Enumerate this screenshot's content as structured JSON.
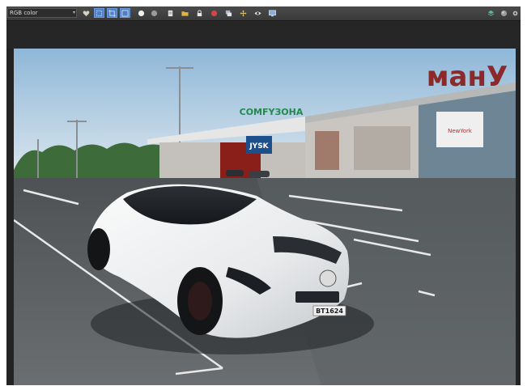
{
  "toolbar": {
    "channel_select_value": "RGB color",
    "tools": [
      {
        "name": "heart-icon",
        "active": false
      },
      {
        "name": "region-select-icon",
        "active": true
      },
      {
        "name": "crop-icon",
        "active": true
      },
      {
        "name": "frame-icon",
        "active": true
      },
      {
        "name": "white-circle-icon",
        "active": false
      },
      {
        "name": "gray-circle-icon",
        "active": false
      },
      {
        "name": "document-icon",
        "active": false
      },
      {
        "name": "folder-icon",
        "active": false
      },
      {
        "name": "lock-icon",
        "active": false
      },
      {
        "name": "red-circle-icon",
        "active": false
      },
      {
        "name": "image-stack-icon",
        "active": false
      },
      {
        "name": "move-icon",
        "active": false
      },
      {
        "name": "eye-icon",
        "active": false
      },
      {
        "name": "monitor-icon",
        "active": false
      }
    ],
    "right_tools": [
      {
        "name": "layers-icon"
      },
      {
        "name": "sphere-icon"
      },
      {
        "name": "settings-icon"
      }
    ]
  },
  "scene": {
    "sign_text": "манУ",
    "store_sign": "COMFYЗОНА",
    "jysk_sign": "JYSK",
    "plate_text": "BT1624"
  },
  "colors": {
    "toolbar_bg": "#3f3f3f",
    "active_tool": "#4f7fc4",
    "window_bg": "#232323"
  }
}
